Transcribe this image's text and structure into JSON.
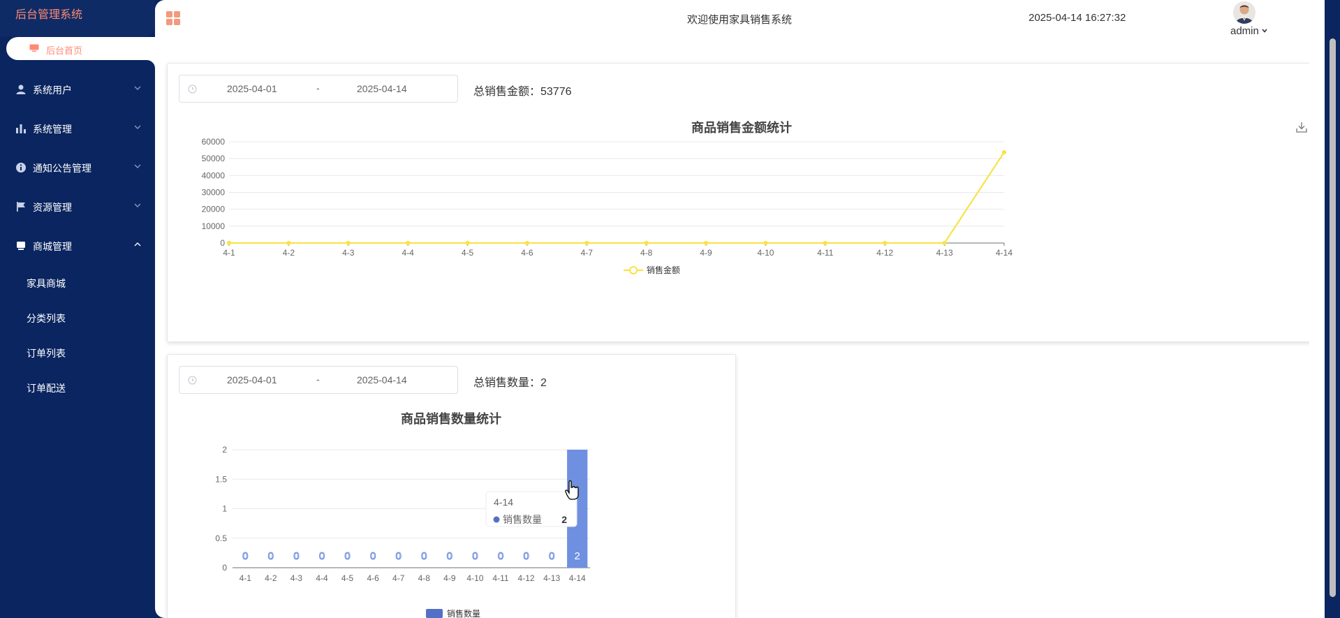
{
  "sidebar": {
    "brand": "后台管理系统",
    "home_label": "后台首页",
    "menus": [
      {
        "label": "系统用户",
        "icon": "user-icon",
        "expanded": false
      },
      {
        "label": "系统管理",
        "icon": "bar-chart-icon",
        "expanded": false
      },
      {
        "label": "通知公告管理",
        "icon": "info-icon",
        "expanded": false
      },
      {
        "label": "资源管理",
        "icon": "flag-icon",
        "expanded": false
      },
      {
        "label": "商城管理",
        "icon": "shop-icon",
        "expanded": true
      }
    ],
    "submenu": [
      "家具商城",
      "分类列表",
      "订单列表",
      "订单配送"
    ]
  },
  "header": {
    "welcome": "欢迎使用家具销售系统",
    "datetime": "2025-04-14 16:27:32",
    "user": "admin"
  },
  "amount_panel": {
    "date_start": "2025-04-01",
    "date_sep": "-",
    "date_end": "2025-04-14",
    "total_label": "总销售金额：53776",
    "title": "商品销售金额统计"
  },
  "quantity_panel": {
    "date_start": "2025-04-01",
    "date_sep": "-",
    "date_end": "2025-04-14",
    "total_label": "总销售数量：2",
    "title": "商品销售数量统计"
  },
  "tooltip": {
    "category": "4-14",
    "series_name": "销售数量",
    "value": "2"
  },
  "chart_data": [
    {
      "type": "line",
      "title": "商品销售金额统计",
      "categories": [
        "4-1",
        "4-2",
        "4-3",
        "4-4",
        "4-5",
        "4-6",
        "4-7",
        "4-8",
        "4-9",
        "4-10",
        "4-11",
        "4-12",
        "4-13",
        "4-14"
      ],
      "series": [
        {
          "name": "销售金额",
          "values": [
            0,
            0,
            0,
            0,
            0,
            0,
            0,
            0,
            0,
            0,
            0,
            0,
            0,
            53776
          ],
          "color": "#f7e34a"
        }
      ],
      "yticks": [
        0,
        10000,
        20000,
        30000,
        40000,
        50000,
        60000
      ],
      "ylim": [
        0,
        60000
      ],
      "grid": true,
      "legend": "bottom"
    },
    {
      "type": "bar",
      "title": "商品销售数量统计",
      "categories": [
        "4-1",
        "4-2",
        "4-3",
        "4-4",
        "4-5",
        "4-6",
        "4-7",
        "4-8",
        "4-9",
        "4-10",
        "4-11",
        "4-12",
        "4-13",
        "4-14"
      ],
      "series": [
        {
          "name": "销售数量",
          "values": [
            0,
            0,
            0,
            0,
            0,
            0,
            0,
            0,
            0,
            0,
            0,
            0,
            0,
            2
          ],
          "color": "#6f8fe0"
        }
      ],
      "yticks": [
        "0",
        "0.5",
        "1",
        "1.5",
        "2"
      ],
      "ylim": [
        0,
        2
      ],
      "grid": true,
      "legend": "bottom"
    }
  ]
}
